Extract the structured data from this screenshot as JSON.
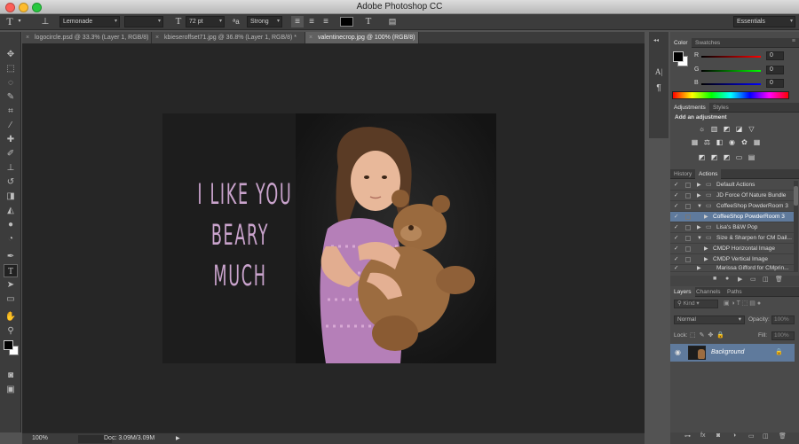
{
  "app": {
    "title": "Adobe Photoshop CC",
    "workspace": "Essentials"
  },
  "options_bar": {
    "font_family": "Lemonade",
    "font_style": "",
    "font_size": "72 pt",
    "antialias": "Strong",
    "icons": [
      "type-tool-icon",
      "orientation-toggle-icon",
      "font-size-icon",
      "antialias-icon",
      "align-left-icon",
      "align-center-icon",
      "align-right-icon",
      "text-color-swatch",
      "warp-text-icon"
    ]
  },
  "tabs": [
    {
      "label": "logocircle.psd @ 33.3% (Layer 1, RGB/8)",
      "close": "×"
    },
    {
      "label": "kbieseroffset71.jpg @ 36.8% (Layer 1, RGB/8) *",
      "close": "×"
    },
    {
      "label": "valentinecrop.jpg @ 100% (RGB/8)",
      "close": "×"
    }
  ],
  "canvas": {
    "quote_lines": [
      "I LIKE YOU",
      "BEARY",
      "MUCH"
    ]
  },
  "status": {
    "zoom": "100%",
    "doc": "Doc: 3.09M/3.09M",
    "arrow": "▶"
  },
  "color_panel": {
    "tabs": [
      "Color",
      "Swatches"
    ],
    "channels": [
      {
        "label": "R",
        "value": "0"
      },
      {
        "label": "G",
        "value": "0"
      },
      {
        "label": "B",
        "value": "0"
      }
    ]
  },
  "adjustments": {
    "tabs": [
      "Adjustments",
      "Styles"
    ],
    "heading": "Add an adjustment"
  },
  "actions": {
    "tabs": [
      "History",
      "Actions"
    ],
    "rows": [
      {
        "name": "Default Actions",
        "indent": 0,
        "folder": true
      },
      {
        "name": "JD Force Of Nature Bundle",
        "indent": 0,
        "folder": true
      },
      {
        "name": "CoffeeShop PowderRoom 3",
        "indent": 0,
        "folder": true,
        "open": true
      },
      {
        "name": "CoffeeShop PowderRoom 3",
        "indent": 1,
        "selected": true
      },
      {
        "name": "Lisa's B&W Pop",
        "indent": 0,
        "folder": true
      },
      {
        "name": "Size & Sharpen for CM Dail...",
        "indent": 0,
        "folder": true,
        "open": true
      },
      {
        "name": "CMDP Horizontal Image",
        "indent": 1
      },
      {
        "name": "CMDP Vertical Image",
        "indent": 1
      },
      {
        "name": "Marissa Gifford for CMprin...",
        "indent": 0,
        "folder": true
      }
    ]
  },
  "layers": {
    "tabs": [
      "Layers",
      "Channels",
      "Paths"
    ],
    "filter": "Kind",
    "blend_mode": "Normal",
    "opacity_label": "Opacity:",
    "opacity": "100%",
    "lock_label": "Lock:",
    "fill_label": "Fill:",
    "fill": "100%",
    "layer_name": "Background"
  },
  "colors": {
    "accent_selected": "#5f7a9c",
    "bg_dark": "#262626",
    "quote_color": "#c9a3cc"
  }
}
